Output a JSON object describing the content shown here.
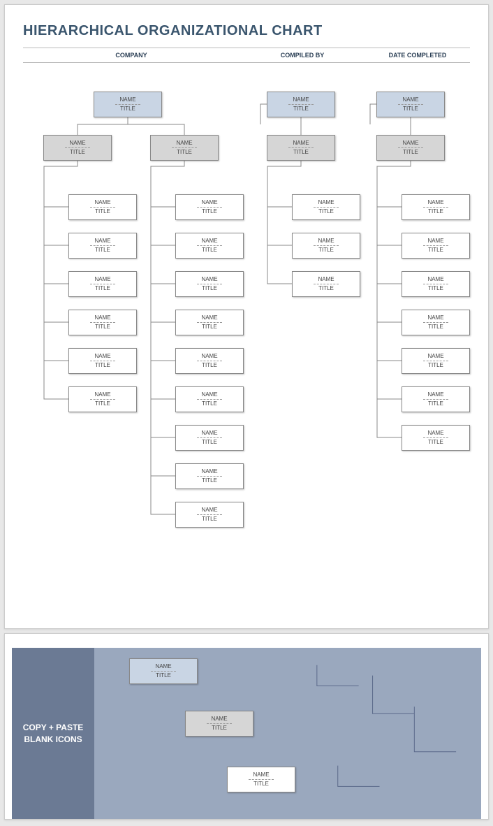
{
  "page_title": "HIERARCHICAL ORGANIZATIONAL CHART",
  "headers": {
    "company": "COMPANY",
    "compiled_by": "COMPILED BY",
    "date_completed": "DATE COMPLETED"
  },
  "labels": {
    "name": "NAME",
    "title": "TITLE"
  },
  "footer_label_line1": "COPY + PASTE",
  "footer_label_line2": "BLANK ICONS",
  "chart_data": {
    "type": "org-chart",
    "columns": [
      {
        "id": "company",
        "top": {
          "style": "blue",
          "name": "NAME",
          "title": "TITLE"
        },
        "mids": [
          {
            "style": "grey",
            "name": "NAME",
            "title": "TITLE",
            "children_count": 6
          },
          {
            "style": "grey",
            "name": "NAME",
            "title": "TITLE",
            "children_count": 9
          }
        ]
      },
      {
        "id": "compiled_by",
        "top": {
          "style": "blue",
          "name": "NAME",
          "title": "TITLE"
        },
        "mids": [
          {
            "style": "grey",
            "name": "NAME",
            "title": "TITLE",
            "children_count": 3
          }
        ]
      },
      {
        "id": "date_completed",
        "top": {
          "style": "blue",
          "name": "NAME",
          "title": "TITLE"
        },
        "mids": [
          {
            "style": "grey",
            "name": "NAME",
            "title": "TITLE",
            "children_count": 7
          }
        ]
      }
    ],
    "palette_boxes": [
      {
        "style": "blue",
        "name": "NAME",
        "title": "TITLE"
      },
      {
        "style": "grey",
        "name": "NAME",
        "title": "TITLE"
      },
      {
        "style": "white",
        "name": "NAME",
        "title": "TITLE"
      }
    ]
  }
}
